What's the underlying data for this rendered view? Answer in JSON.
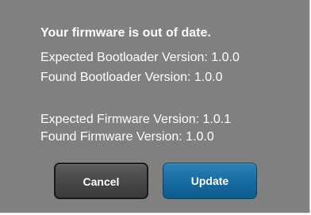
{
  "dialog": {
    "title": "Your firmware is out of date.",
    "lines": [
      "Expected Bootloader Version: 1.0.0",
      "Found Bootloader Version: 1.0.0",
      "Expected Firmware Version: 1.0.1",
      "Found Firmware Version: 1.0.0"
    ],
    "buttons": {
      "cancel_label": "Cancel",
      "update_label": "Update"
    }
  },
  "colors": {
    "dialog_background": "#808080",
    "primary_button": "#166a9f",
    "secondary_button": "#464646",
    "text": "#ffffff"
  }
}
